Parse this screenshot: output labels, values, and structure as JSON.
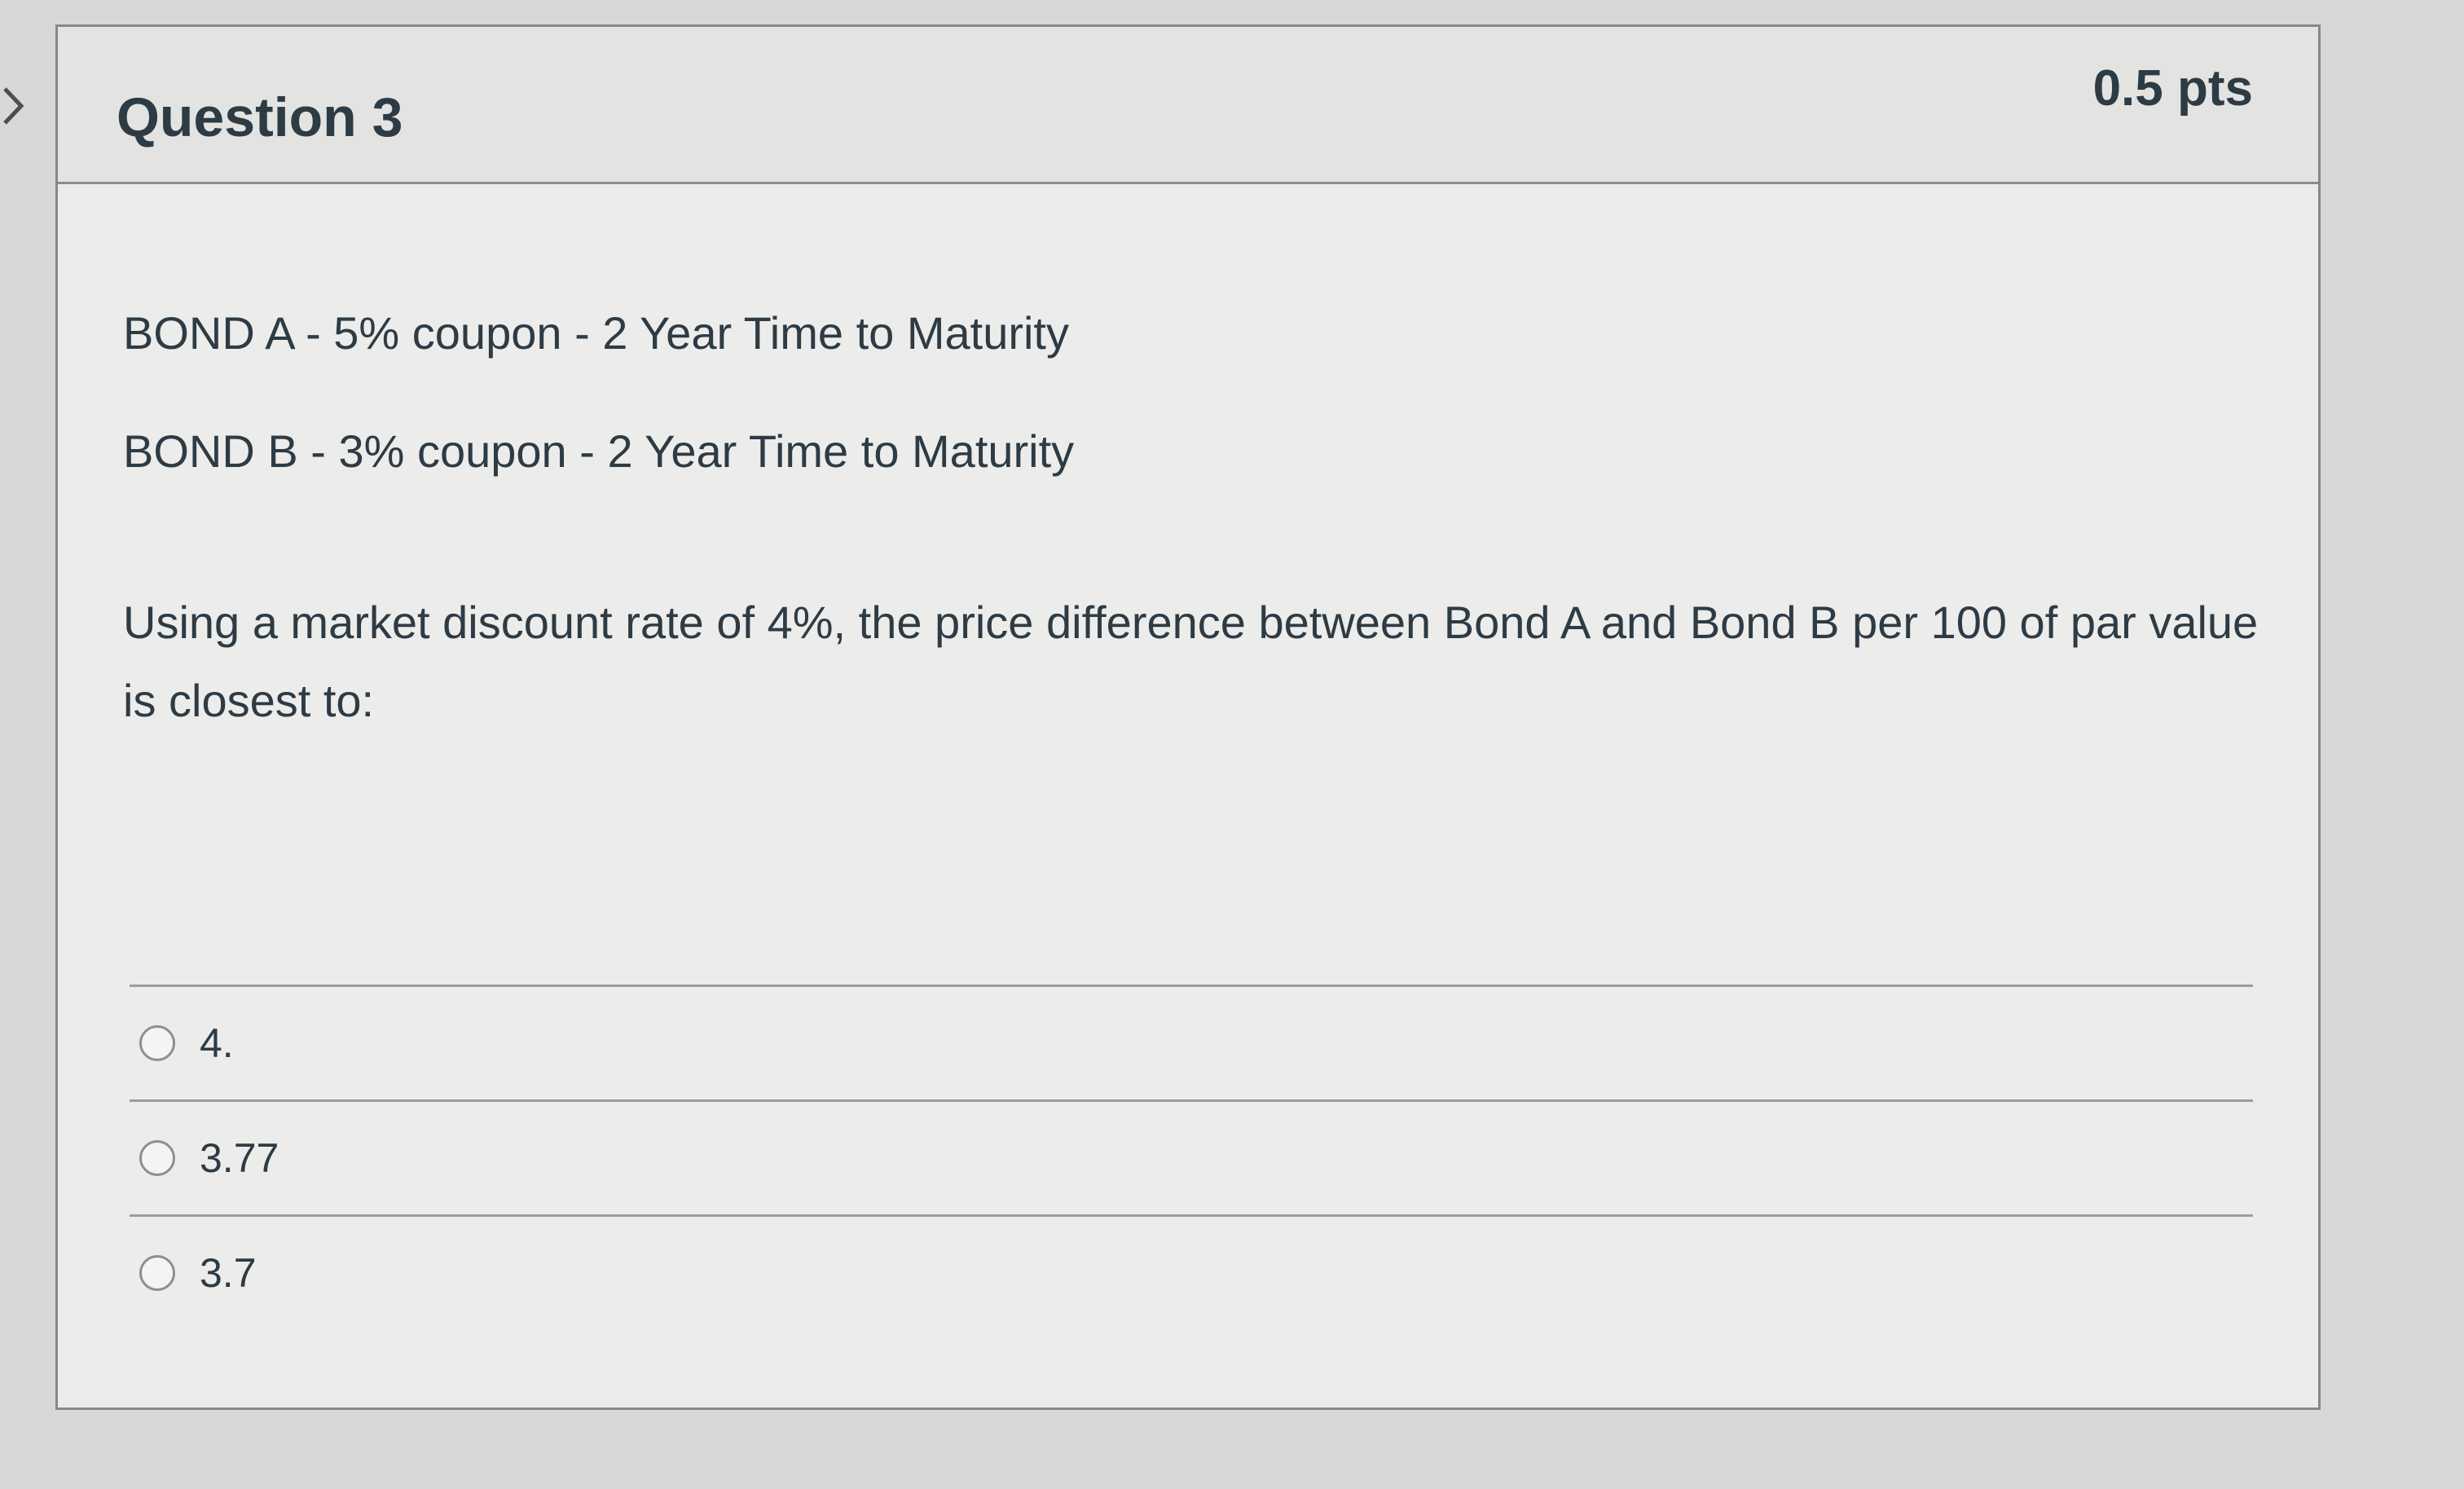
{
  "question": {
    "title": "Question 3",
    "points": "0.5 pts",
    "bond_a": "BOND A - 5% coupon - 2 Year Time to Maturity",
    "bond_b": "BOND B - 3% coupon - 2 Year Time to Maturity",
    "prompt": "Using a market discount rate of 4%, the price difference between Bond A and Bond B per 100 of par value is closest to:"
  },
  "answers": [
    {
      "label": "4."
    },
    {
      "label": "3.77"
    },
    {
      "label": "3.7"
    }
  ],
  "icons": {
    "collapse": "chevron-right-icon"
  }
}
